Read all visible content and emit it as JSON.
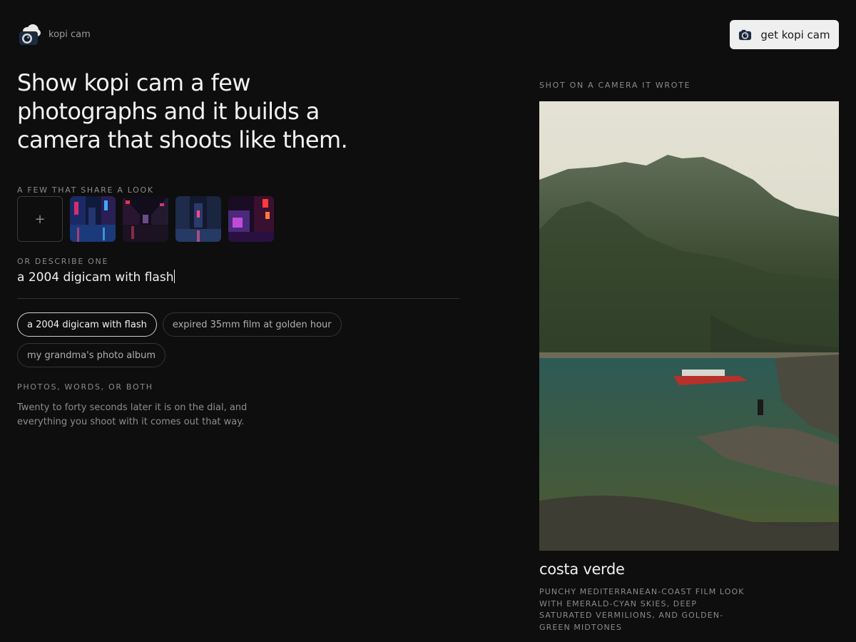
{
  "app": {
    "name": "kopi cam"
  },
  "header": {
    "cta_label": "get kopi cam"
  },
  "hero": {
    "headline": "Show kopi cam a few photographs and it builds a camera that shoots like them."
  },
  "photos_section": {
    "caption": "A FEW THAT SHARE A LOOK",
    "add_symbol": "+",
    "thumbnails": [
      "neon-street-1",
      "neon-street-2",
      "neon-street-3",
      "neon-street-4"
    ]
  },
  "describe": {
    "caption": "OR DESCRIBE ONE",
    "value": "a 2004 digicam with flash",
    "suggestions": [
      {
        "label": "a 2004 digicam with flash",
        "active": true
      },
      {
        "label": "expired 35mm film at golden hour",
        "active": false
      },
      {
        "label": "my grandma's photo album",
        "active": false
      }
    ]
  },
  "info": {
    "caption": "PHOTOS, WORDS, OR BOTH",
    "body": "Twenty to forty seconds later it is on the dial, and everything you shoot with it comes out that way."
  },
  "showcase": {
    "caption": "SHOT ON A CAMERA IT WROTE",
    "title": "costa verde",
    "description": "PUNCHY MEDITERRANEAN-COAST FILM LOOK WITH EMERALD-CYAN SKIES, DEEP SATURATED VERMILIONS, AND GOLDEN-GREEN MIDTONES"
  },
  "icons": {
    "logo": "camera-icon",
    "cta": "camera-icon",
    "add": "plus-icon"
  },
  "colors": {
    "background": "#0e0e0e",
    "cta_background": "#efefef",
    "text": "#f2f2f2",
    "muted": "#8a8a8a"
  }
}
